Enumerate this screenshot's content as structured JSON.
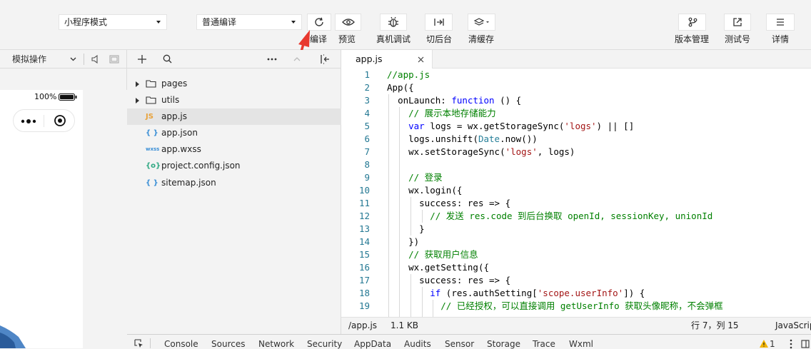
{
  "toolbar": {
    "mode_select": "小程序模式",
    "compile_select": "普通编译",
    "buttons": {
      "compile": "编译",
      "preview": "预览",
      "remote_debug": "真机调试",
      "background": "切后台",
      "clear_cache": "清缓存",
      "version": "版本管理",
      "test_account": "测试号",
      "details": "详情"
    }
  },
  "simulator": {
    "panel_select": "模拟操作",
    "battery": "100%"
  },
  "file_tree": {
    "items": [
      {
        "name": "pages",
        "type": "folder"
      },
      {
        "name": "utils",
        "type": "folder"
      },
      {
        "name": "app.js",
        "type": "js",
        "icon": "JS"
      },
      {
        "name": "app.json",
        "type": "json",
        "icon": "{ }"
      },
      {
        "name": "app.wxss",
        "type": "wxss",
        "icon": "wxss"
      },
      {
        "name": "project.config.json",
        "type": "config",
        "icon": "{o}"
      },
      {
        "name": "sitemap.json",
        "type": "json",
        "icon": "{ }"
      }
    ]
  },
  "editor": {
    "tab": "app.js",
    "lines": [
      "//app.js",
      "App({",
      "  onLaunch: function () {",
      "    // 展示本地存储能力",
      "    var logs = wx.getStorageSync('logs') || []",
      "    logs.unshift(Date.now())",
      "    wx.setStorageSync('logs', logs)",
      "",
      "    // 登录",
      "    wx.login({",
      "      success: res => {",
      "        // 发送 res.code 到后台换取 openId, sessionKey, unionId",
      "      }",
      "    })",
      "    // 获取用户信息",
      "    wx.getSetting({",
      "      success: res => {",
      "        if (res.authSetting['scope.userInfo']) {",
      "          // 已经授权，可以直接调用 getUserInfo 获取头像昵称，不会弹框"
    ]
  },
  "status": {
    "path": "/app.js",
    "size": "1.1 KB",
    "position": "行 7，列 15",
    "language": "JavaScript"
  },
  "devtools_tabs": [
    "Console",
    "Sources",
    "Network",
    "Security",
    "AppData",
    "Audits",
    "Sensor",
    "Storage",
    "Trace",
    "Wxml"
  ],
  "warning_count": "1",
  "colors": {
    "arrow": "#e8382e",
    "js_icon": "#e8a23a",
    "json_icon": "#3b8fd6",
    "config_icon": "#2fa882"
  }
}
